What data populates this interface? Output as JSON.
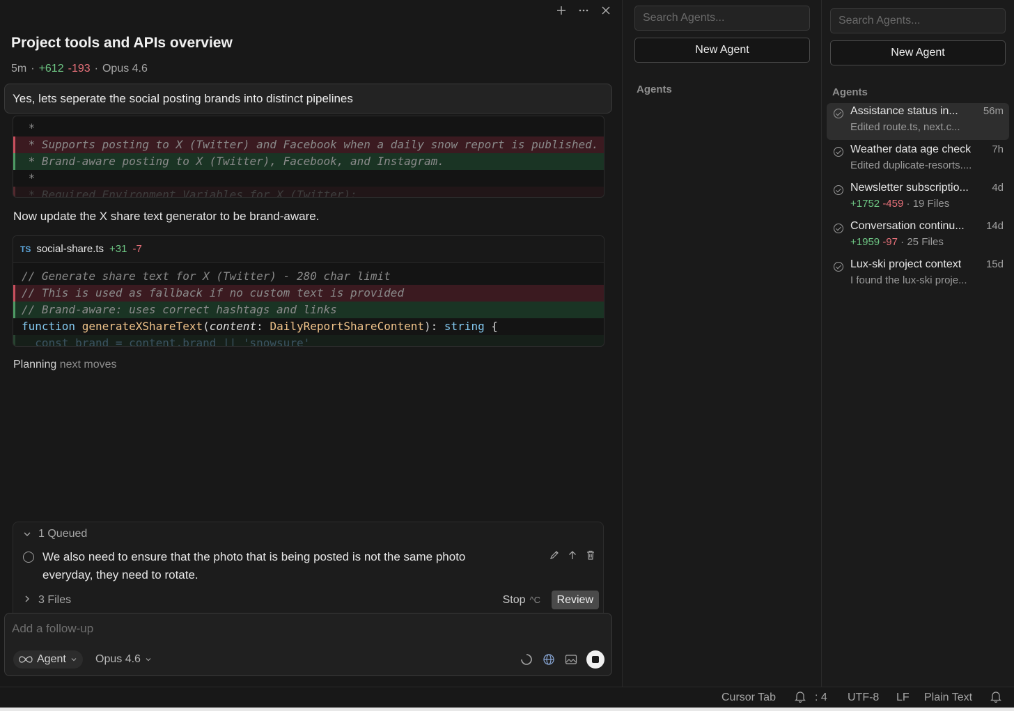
{
  "header": {
    "title": "Project tools and APIs overview",
    "elapsed": "5m",
    "additions": "+612",
    "deletions": "-193",
    "model": "Opus 4.6"
  },
  "user_message": "Yes, lets seperate the social posting brands into distinct pipelines",
  "diff1": {
    "line1": " *",
    "line2": " * Supports posting to X (Twitter) and Facebook when a daily snow report is published.",
    "line3": " * Brand-aware posting to X (Twitter), Facebook, and Instagram.",
    "line4": " *",
    "line5": " * Required Environment Variables for X (Twitter):"
  },
  "narration": "Now update the X share text generator to be brand-aware.",
  "diff2": {
    "lang": "TS",
    "filename": "social-share.ts",
    "additions": "+31",
    "deletions": "-7",
    "line1": "// Generate share text for X (Twitter) - 280 char limit",
    "line2": "// This is used as fallback if no custom text is provided",
    "line3": "// Brand-aware: uses correct hashtags and links",
    "line4": {
      "kw": "function",
      "fn": "generateXShareText",
      "param": "content",
      "type": "DailyReportShareContent",
      "ret": "string"
    },
    "line5": "  const brand = content.brand || 'snowsure'"
  },
  "status": {
    "planning_bold": "Planning",
    "planning_rest": " next moves"
  },
  "queue": {
    "header": "1 Queued",
    "item": "We also need to ensure that the photo that is being posted is not the same photo everyday, they need to rotate."
  },
  "files_bar": {
    "files": "3 Files",
    "stop": "Stop",
    "stop_shortcut": "^C",
    "review": "Review"
  },
  "composer": {
    "placeholder": "Add a follow-up",
    "mode": "Agent",
    "model": "Opus 4.6"
  },
  "mid_panel": {
    "search_placeholder": "Search Agents...",
    "new_agent": "New Agent",
    "agents_label": "Agents"
  },
  "right_panel": {
    "search_placeholder": "Search Agents...",
    "new_agent": "New Agent",
    "agents_label": "Agents",
    "items": [
      {
        "title": "Assistance status in...",
        "time": "56m",
        "sub": "Edited route.ts, next.c..."
      },
      {
        "title": "Weather data age check",
        "time": "7h",
        "sub": "Edited duplicate-resorts...."
      },
      {
        "title": "Newsletter subscriptio...",
        "time": "4d",
        "add": "+1752",
        "del": "-459",
        "files": "19 Files"
      },
      {
        "title": "Conversation continu...",
        "time": "14d",
        "add": "+1959",
        "del": "-97",
        "files": "25 Files"
      },
      {
        "title": "Lux-ski project context",
        "time": "15d",
        "sub": "I found the lux-ski proje..."
      }
    ]
  },
  "statusbar": {
    "cursor_tab": "Cursor Tab",
    "spaces": ": 4",
    "encoding": "UTF-8",
    "eol": "LF",
    "language": "Plain Text"
  },
  "colors": {
    "addition": "#6ec784",
    "deletion": "#e8717a",
    "background": "#181818"
  }
}
